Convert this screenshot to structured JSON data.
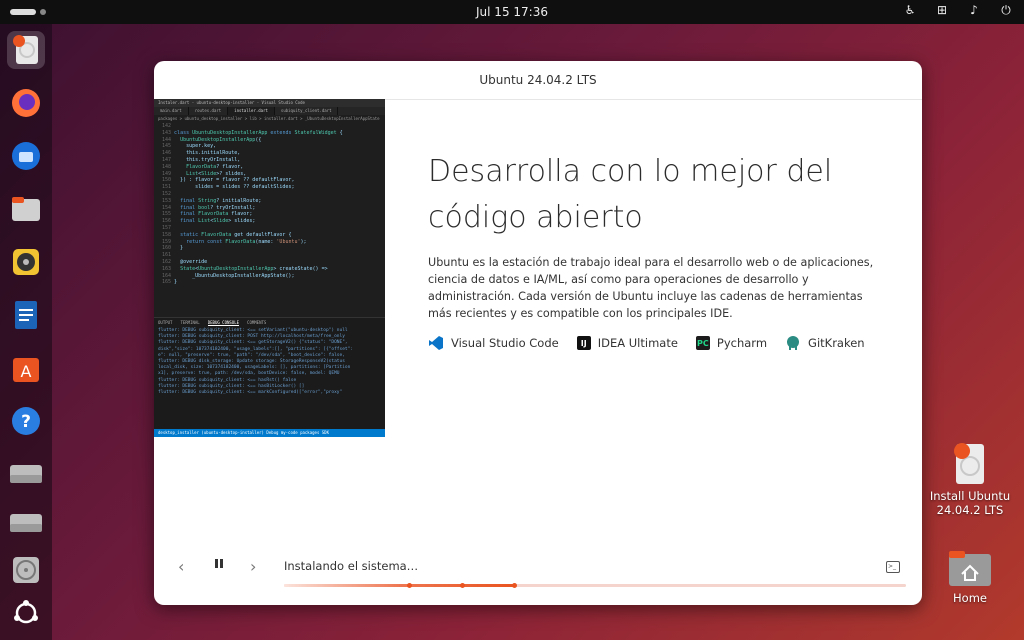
{
  "topbar": {
    "clock": "Jul 15  17:36"
  },
  "dock": {
    "items": [
      {
        "name": "ubuntu-installer"
      },
      {
        "name": "firefox"
      },
      {
        "name": "thunderbird"
      },
      {
        "name": "files"
      },
      {
        "name": "rhythmbox"
      },
      {
        "name": "writer"
      },
      {
        "name": "app-center"
      },
      {
        "name": "help"
      },
      {
        "name": "drive-1"
      },
      {
        "name": "drive-2"
      },
      {
        "name": "optical-drive"
      },
      {
        "name": "show-apps"
      }
    ]
  },
  "window": {
    "title": "Ubuntu 24.04.2 LTS",
    "heading": "Desarrolla con lo mejor del código abierto",
    "description": "Ubuntu es la estación de trabajo ideal para el desarrollo web o de aplicaciones, ciencia de datos e IA/ML, así como para operaciones de desarrollo y administración. Cada versión de Ubuntu incluye las cadenas de herramientas más recientes y es compatible con los principales IDE.",
    "tools": [
      {
        "label": "Visual Studio Code",
        "color": "#0a74c8"
      },
      {
        "label": "IDEA Ultimate",
        "color": "#111111"
      },
      {
        "label": "Pycharm",
        "color": "#1c1c1c"
      },
      {
        "label": "GitKraken",
        "color": "#2a8c82"
      }
    ],
    "status": "Instalando el sistema…",
    "progress": 0.37,
    "vscode": {
      "title": "Instaler.dart - ubuntu-desktop-installer - Visual Studio Code",
      "tabs": [
        "main.dart",
        "routes.dart",
        "installer.dart",
        "subiquity_client.dart"
      ],
      "crumb": "packages > ubuntu_desktop_installer > lib > installer.dart > _UbuntuDesktopInstallerAppState",
      "panel_tabs": [
        "OUTPUT",
        "TERMINAL",
        "DEBUG CONSOLE",
        "COMMENTS"
      ],
      "statusbar": "desktop_installer (ubuntu-desktop-installer)   Debug my-code  packages  SDK"
    }
  },
  "desktop": {
    "install": "Install Ubuntu\n24.04.2 LTS",
    "home": "Home"
  }
}
